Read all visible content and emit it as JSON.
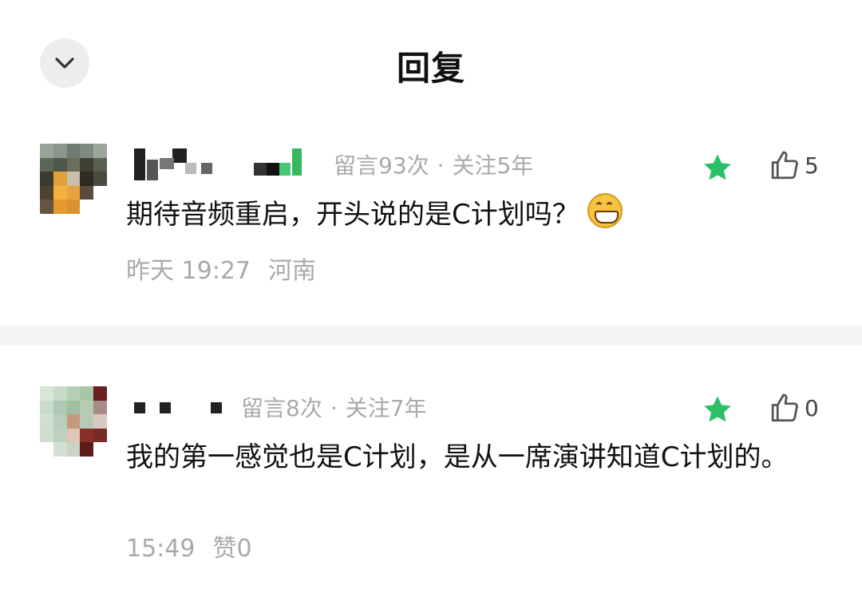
{
  "header": {
    "title": "回复",
    "collapse_icon": "chevron-down-icon"
  },
  "colors": {
    "star": "#2bbf68",
    "meta_text": "#a9a9a9",
    "divider": "#f3f3f3"
  },
  "comments": [
    {
      "meta_count": "留言93次",
      "meta_follow": "关注5年",
      "like_count": "5",
      "text": "期待音频重启，开头说的是C计划吗？",
      "emoji": "grinning-face",
      "time": "昨天 19:27",
      "location": "河南"
    },
    {
      "meta_count": "留言8次",
      "meta_follow": "关注7年",
      "like_count": "0",
      "text": "我的第一感觉也是C计划，是从一席演讲知道C计划的。",
      "time": "15:49",
      "reply_likes": "赞0"
    }
  ]
}
